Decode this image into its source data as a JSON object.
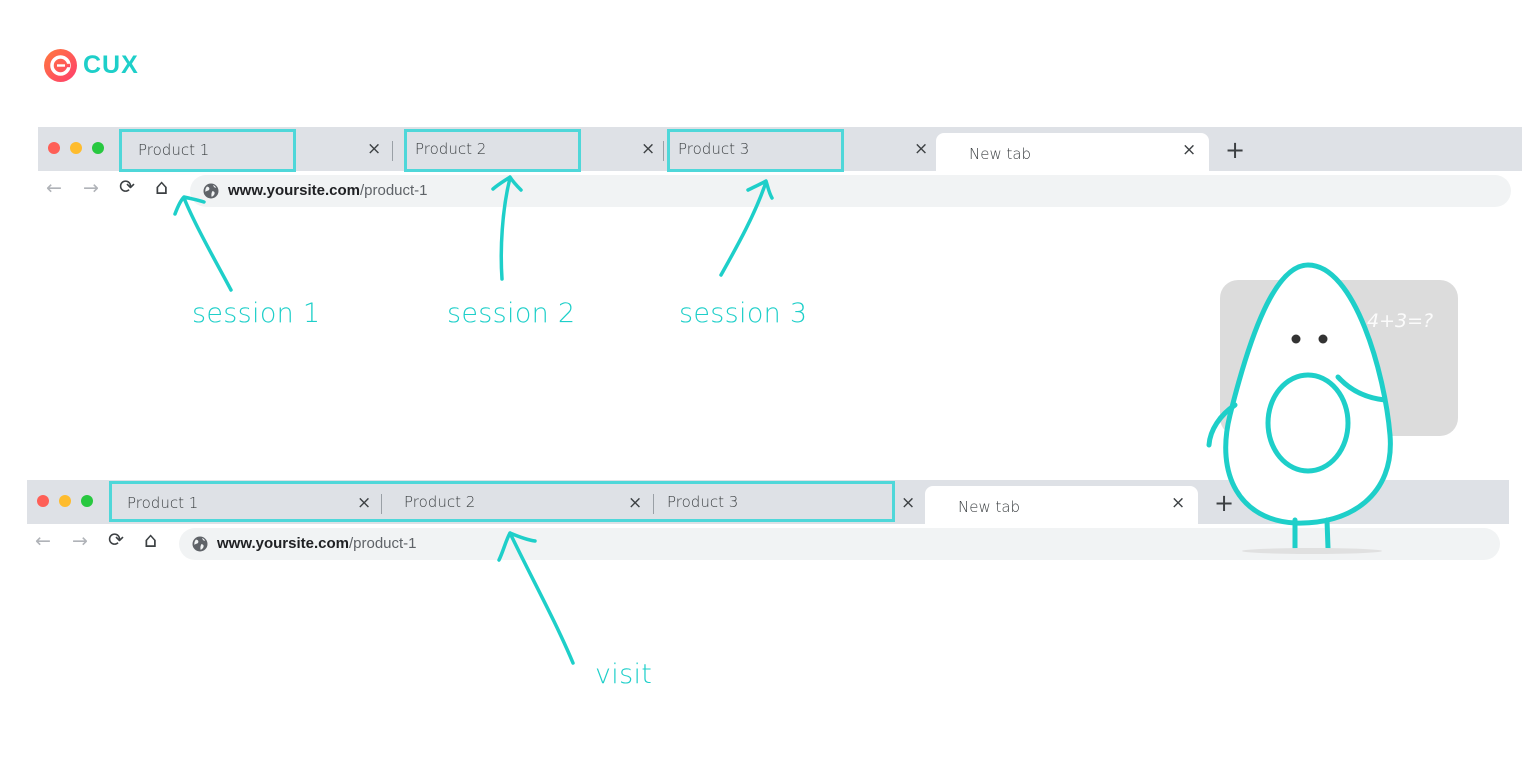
{
  "logo": {
    "text": "CUX",
    "icon": "cux-logo-icon"
  },
  "colors": {
    "accent": "#1ecfc9",
    "highlight": "#4fd7d9",
    "tabbar": "#dee1e6",
    "omnibox": "#f1f3f4"
  },
  "browser_top": {
    "tabs": [
      {
        "label": "Product 1"
      },
      {
        "label": "Product 2"
      },
      {
        "label": "Product 3"
      },
      {
        "label": "New tab",
        "active": true
      }
    ],
    "new_tab_icon": "+",
    "close_icon": "×",
    "url_host": "www.yoursite.com",
    "url_path": "/product-1",
    "nav": {
      "back": "←",
      "forward": "→",
      "reload": "⟳",
      "home": "⌂"
    }
  },
  "browser_bottom": {
    "tabs": [
      {
        "label": "Product 1"
      },
      {
        "label": "Product 2"
      },
      {
        "label": "Product 3"
      },
      {
        "label": "New tab",
        "active": true
      }
    ],
    "new_tab_icon": "+",
    "close_icon": "×",
    "url_host": "www.yoursite.com",
    "url_path": "/product-1",
    "nav": {
      "back": "←",
      "forward": "→",
      "reload": "⟳",
      "home": "⌂"
    }
  },
  "annotations": {
    "session1": "session 1",
    "session2": "session 2",
    "session3": "session 3",
    "visit": "visit"
  },
  "mascot": {
    "chalkboard_text": "4+3=?"
  }
}
